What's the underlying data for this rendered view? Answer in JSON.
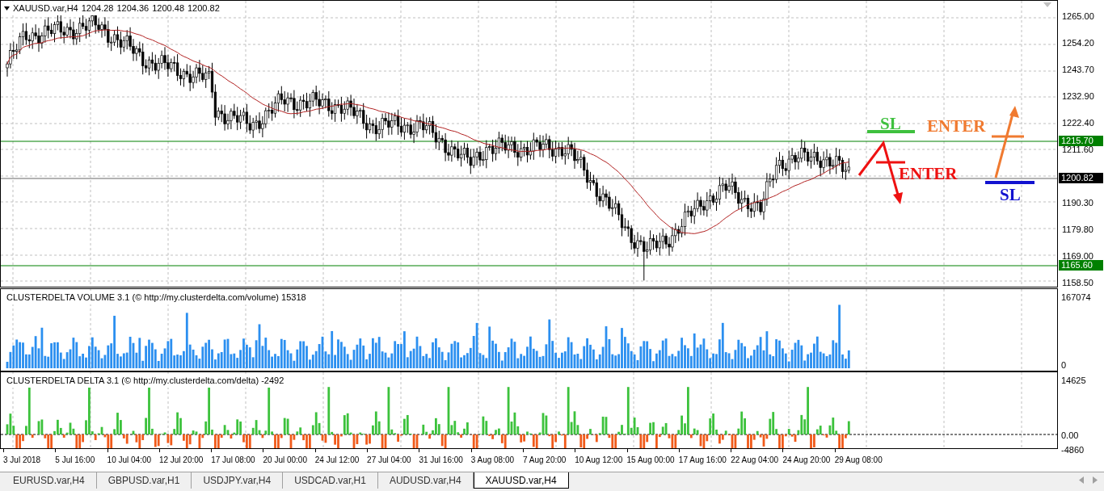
{
  "chart": {
    "title": "XAUUSD.var,H4",
    "ohlc": [
      "1204.28",
      "1204.36",
      "1200.48",
      "1200.82"
    ]
  },
  "price_axis": [
    "1265.00",
    "1254.20",
    "1243.70",
    "1232.90",
    "1222.40",
    "1211.60",
    "1190.30",
    "1179.80",
    "1169.00",
    "1158.50"
  ],
  "levels": [
    {
      "price": "1215.70",
      "color": "#008000"
    },
    {
      "price": "1200.82",
      "color": "#000000"
    },
    {
      "price": "1165.60",
      "color": "#008000"
    }
  ],
  "annotations": [
    {
      "label": "SL",
      "color": "#3ec03e"
    },
    {
      "label": "ENTER",
      "color": "#f07a30"
    },
    {
      "label": "ENTER",
      "color": "#ee1111"
    },
    {
      "label": "SL",
      "color": "#1212d0"
    }
  ],
  "volume": {
    "title": "CLUSTERDELTA VOLUME 3.1 (© http://my.clusterdelta.com/volume) 15318",
    "axis": [
      "167074",
      "0"
    ]
  },
  "delta": {
    "title": "CLUSTERDELTA DELTA 3.1 (© http://my.clusterdelta.com/delta) -2492",
    "axis": [
      "14625",
      "0.00",
      "-4860"
    ]
  },
  "time_axis": [
    "3 Jul 2018",
    "5 Jul 16:00",
    "10 Jul 04:00",
    "12 Jul 20:00",
    "17 Jul 08:00",
    "20 Jul 00:00",
    "24 Jul 12:00",
    "27 Jul 04:00",
    "31 Jul 16:00",
    "3 Aug 08:00",
    "7 Aug 20:00",
    "10 Aug 12:00",
    "15 Aug 00:00",
    "17 Aug 16:00",
    "22 Aug 04:00",
    "24 Aug 20:00",
    "29 Aug 08:00"
  ],
  "tabs": [
    {
      "label": "EURUSD.var,H4",
      "selected": false
    },
    {
      "label": "GBPUSD.var,H1",
      "selected": false
    },
    {
      "label": "USDJPY.var,H4",
      "selected": false
    },
    {
      "label": "USDCAD.var,H1",
      "selected": false
    },
    {
      "label": "AUDUSD.var,H4",
      "selected": false
    },
    {
      "label": "XAUUSD.var,H4",
      "selected": true
    }
  ]
}
